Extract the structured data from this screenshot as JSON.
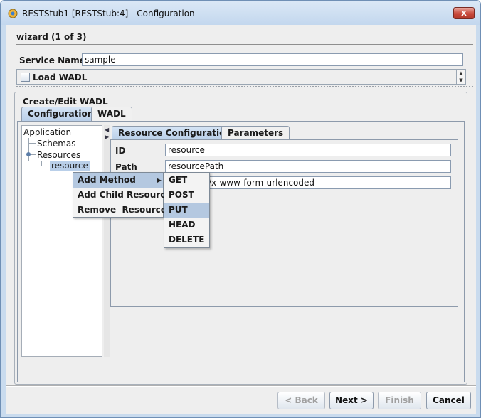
{
  "window": {
    "title": "RESTStub1 [RESTStub:4] - Configuration",
    "close_glyph": "x"
  },
  "wizard": {
    "step_label": "wizard (1 of 3)"
  },
  "service": {
    "label": "Service Name",
    "value": "sample"
  },
  "load_wadl": {
    "label": "Load WADL",
    "checked": false
  },
  "group": {
    "title": "Create/Edit WADL"
  },
  "outer_tabs": [
    {
      "label": "Configuration",
      "active": true
    },
    {
      "label": "WADL",
      "active": false
    }
  ],
  "tree": {
    "items": [
      {
        "label": "Application"
      },
      {
        "label": "Schemas"
      },
      {
        "label": "Resources"
      },
      {
        "label": "resource",
        "selected": true
      }
    ]
  },
  "inner_tabs": [
    {
      "label": "Resource Configuration",
      "active": true
    },
    {
      "label": "Parameters",
      "active": false
    }
  ],
  "fields": {
    "id_label": "ID",
    "id_value": "resource",
    "path_label": "Path",
    "path_value": "resourcePath",
    "type_value": "/x-www-form-urlencoded"
  },
  "context_menu": {
    "items": [
      {
        "label": "Add Method",
        "highlighted": true,
        "has_submenu": true
      },
      {
        "label": "Add Child Resource"
      },
      {
        "label": "Remove  Resource"
      }
    ]
  },
  "method_submenu": {
    "items": [
      {
        "label": "GET"
      },
      {
        "label": "POST"
      },
      {
        "label": "PUT",
        "highlighted": true
      },
      {
        "label": "HEAD"
      },
      {
        "label": "DELETE"
      }
    ]
  },
  "buttons": {
    "back": {
      "prefix": "< ",
      "mnemonic": "B",
      "rest": "ack",
      "enabled": false
    },
    "next": {
      "label": "Next >",
      "enabled": true
    },
    "finish": {
      "label": "Finish",
      "enabled": false
    },
    "cancel": {
      "label": "Cancel",
      "enabled": true
    }
  },
  "colors": {
    "title_bar": "#c3d7ee",
    "highlight": "#b4c8e0",
    "selected_tab": "#b9cfe9"
  }
}
